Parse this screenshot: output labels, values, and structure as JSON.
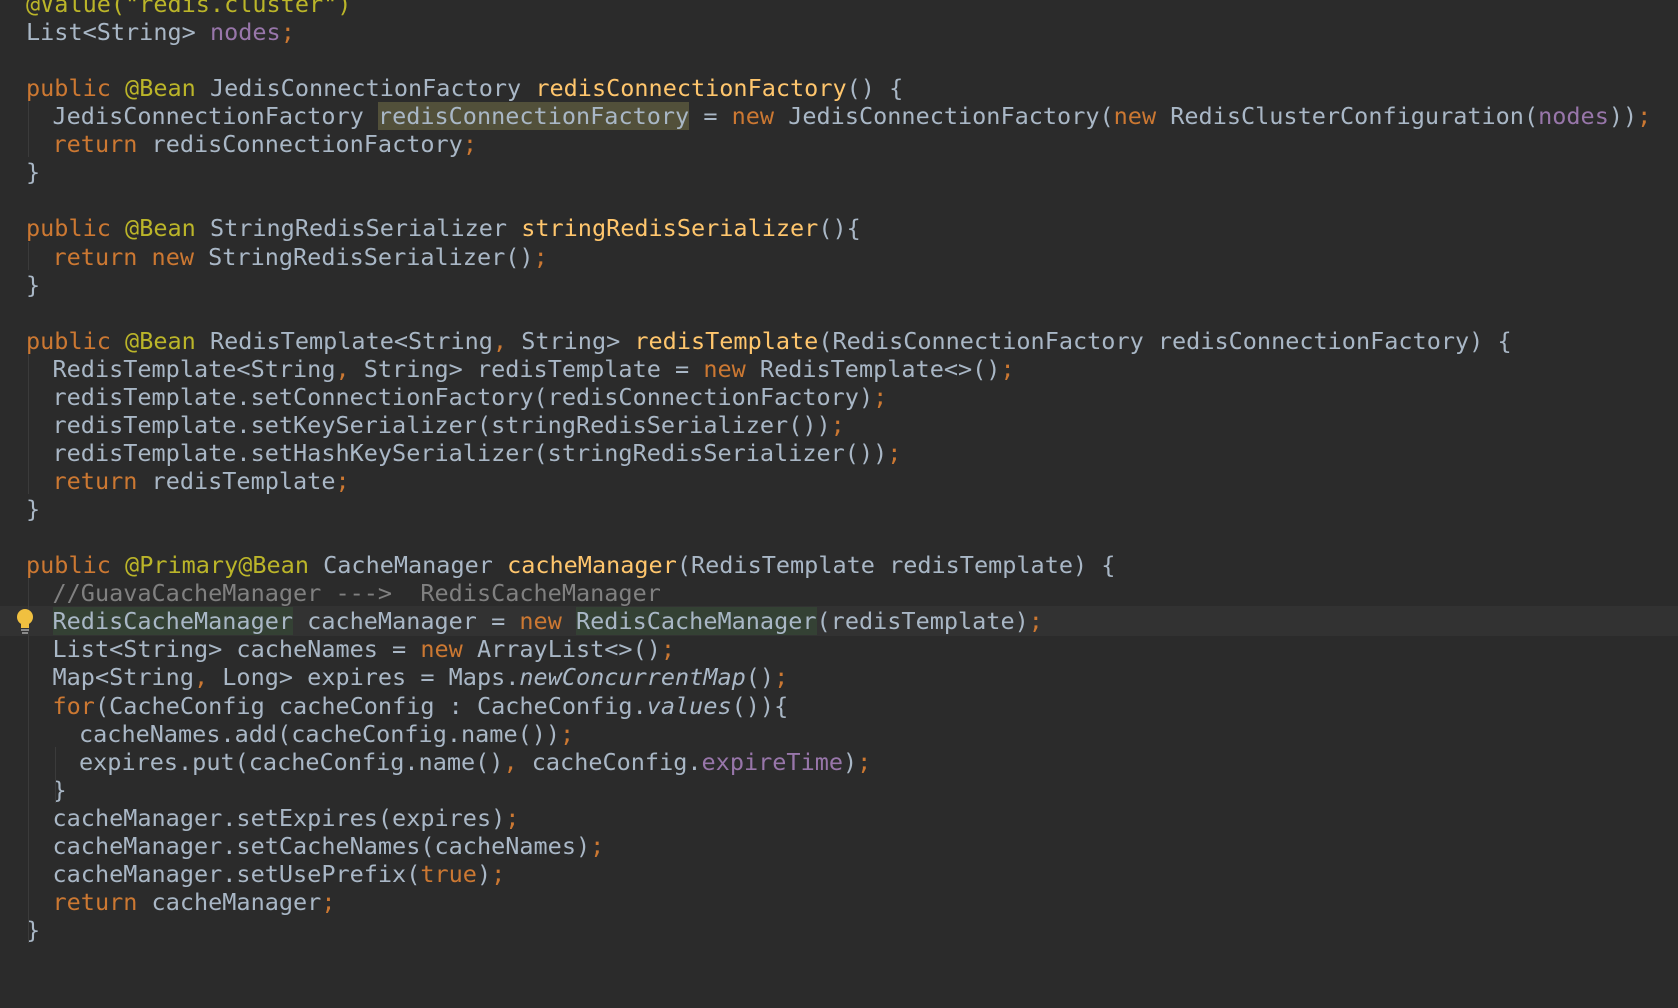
{
  "editor": {
    "language": "java",
    "colors": {
      "background": "#2b2b2b",
      "caret_line": "#323232",
      "keyword": "#cc7832",
      "annotation": "#bbb529",
      "method_declaration": "#ffc66d",
      "field": "#9876aa",
      "plain": "#a9b7c6",
      "comment": "#808080"
    },
    "lightbulb_icon": "intention-bulb-icon",
    "lines": [
      {
        "indent": 0,
        "tokens": [
          {
            "t": "@Value(\"redis.cluster\")",
            "c": "ann"
          }
        ]
      },
      {
        "indent": 0,
        "tokens": [
          {
            "t": "List<String> ",
            "c": "plain"
          },
          {
            "t": "nodes",
            "c": "field"
          },
          {
            "t": ";",
            "c": "punct"
          }
        ]
      },
      {
        "indent": 0,
        "tokens": []
      },
      {
        "indent": 0,
        "tokens": [
          {
            "t": "public ",
            "c": "kw"
          },
          {
            "t": "@Bean ",
            "c": "ann"
          },
          {
            "t": "JedisConnectionFactory ",
            "c": "plain"
          },
          {
            "t": "redisConnectionFactory",
            "c": "fn"
          },
          {
            "t": "() {",
            "c": "plain"
          }
        ]
      },
      {
        "indent": 1,
        "tokens": [
          {
            "t": "JedisConnectionFactory ",
            "c": "plain"
          },
          {
            "t": "redisConnectionFactory",
            "c": "plain",
            "hl": "strong"
          },
          {
            "t": " = ",
            "c": "plain"
          },
          {
            "t": "new ",
            "c": "kw"
          },
          {
            "t": "JedisConnectionFactory(",
            "c": "plain"
          },
          {
            "t": "new ",
            "c": "kw"
          },
          {
            "t": "RedisClusterConfiguration(",
            "c": "plain"
          },
          {
            "t": "nodes",
            "c": "field"
          },
          {
            "t": "))",
            "c": "plain"
          },
          {
            "t": ";",
            "c": "punct"
          }
        ]
      },
      {
        "indent": 1,
        "tokens": [
          {
            "t": "return ",
            "c": "kw"
          },
          {
            "t": "redisConnectionFactory",
            "c": "plain"
          },
          {
            "t": ";",
            "c": "punct"
          }
        ]
      },
      {
        "indent": 0,
        "tokens": [
          {
            "t": "}",
            "c": "plain"
          }
        ]
      },
      {
        "indent": 0,
        "tokens": []
      },
      {
        "indent": 0,
        "tokens": [
          {
            "t": "public ",
            "c": "kw"
          },
          {
            "t": "@Bean ",
            "c": "ann"
          },
          {
            "t": "StringRedisSerializer ",
            "c": "plain"
          },
          {
            "t": "stringRedisSerializer",
            "c": "fn"
          },
          {
            "t": "(){",
            "c": "plain"
          }
        ]
      },
      {
        "indent": 1,
        "tokens": [
          {
            "t": "return ",
            "c": "kw"
          },
          {
            "t": "new ",
            "c": "kw"
          },
          {
            "t": "StringRedisSerializer()",
            "c": "plain"
          },
          {
            "t": ";",
            "c": "punct"
          }
        ]
      },
      {
        "indent": 0,
        "tokens": [
          {
            "t": "}",
            "c": "plain"
          }
        ]
      },
      {
        "indent": 0,
        "tokens": []
      },
      {
        "indent": 0,
        "tokens": [
          {
            "t": "public ",
            "c": "kw"
          },
          {
            "t": "@Bean ",
            "c": "ann"
          },
          {
            "t": "RedisTemplate<String",
            "c": "plain"
          },
          {
            "t": ", ",
            "c": "punct"
          },
          {
            "t": "String> ",
            "c": "plain"
          },
          {
            "t": "redisTemplate",
            "c": "fn"
          },
          {
            "t": "(RedisConnectionFactory redisConnectionFactory) {",
            "c": "plain"
          }
        ]
      },
      {
        "indent": 1,
        "tokens": [
          {
            "t": "RedisTemplate<String",
            "c": "plain"
          },
          {
            "t": ", ",
            "c": "punct"
          },
          {
            "t": "String> redisTemplate = ",
            "c": "plain"
          },
          {
            "t": "new ",
            "c": "kw"
          },
          {
            "t": "RedisTemplate<>()",
            "c": "plain"
          },
          {
            "t": ";",
            "c": "punct"
          }
        ]
      },
      {
        "indent": 1,
        "tokens": [
          {
            "t": "redisTemplate.setConnectionFactory(redisConnectionFactory)",
            "c": "plain"
          },
          {
            "t": ";",
            "c": "punct"
          }
        ]
      },
      {
        "indent": 1,
        "tokens": [
          {
            "t": "redisTemplate.setKeySerializer(stringRedisSerializer())",
            "c": "plain"
          },
          {
            "t": ";",
            "c": "punct"
          }
        ]
      },
      {
        "indent": 1,
        "tokens": [
          {
            "t": "redisTemplate.setHashKeySerializer(stringRedisSerializer())",
            "c": "plain"
          },
          {
            "t": ";",
            "c": "punct"
          }
        ]
      },
      {
        "indent": 1,
        "tokens": [
          {
            "t": "return ",
            "c": "kw"
          },
          {
            "t": "redisTemplate",
            "c": "plain"
          },
          {
            "t": ";",
            "c": "punct"
          }
        ]
      },
      {
        "indent": 0,
        "tokens": [
          {
            "t": "}",
            "c": "plain"
          }
        ]
      },
      {
        "indent": 0,
        "tokens": []
      },
      {
        "indent": 0,
        "tokens": [
          {
            "t": "public ",
            "c": "kw"
          },
          {
            "t": "@Primary@Bean ",
            "c": "ann"
          },
          {
            "t": "CacheManager ",
            "c": "plain"
          },
          {
            "t": "cacheManager",
            "c": "fn"
          },
          {
            "t": "(RedisTemplate redisTemplate) {",
            "c": "plain"
          }
        ]
      },
      {
        "indent": 1,
        "tokens": [
          {
            "t": "//GuavaCacheManager --->  RedisCacheManager",
            "c": "comment"
          }
        ]
      },
      {
        "indent": 1,
        "caret": true,
        "tokens": [
          {
            "t": "RedisCacheManager",
            "c": "plain",
            "hl": "usage"
          },
          {
            "t": " cacheManager = ",
            "c": "plain"
          },
          {
            "t": "new ",
            "c": "kw"
          },
          {
            "t": "RedisCacheManager",
            "c": "plain",
            "hl": "usage"
          },
          {
            "t": "(redisTemplate)",
            "c": "plain"
          },
          {
            "t": ";",
            "c": "punct"
          }
        ]
      },
      {
        "indent": 1,
        "tokens": [
          {
            "t": "List<String> cacheNames = ",
            "c": "plain"
          },
          {
            "t": "new ",
            "c": "kw"
          },
          {
            "t": "ArrayList<>()",
            "c": "plain"
          },
          {
            "t": ";",
            "c": "punct"
          }
        ]
      },
      {
        "indent": 1,
        "tokens": [
          {
            "t": "Map<String",
            "c": "plain"
          },
          {
            "t": ", ",
            "c": "punct"
          },
          {
            "t": "Long> expires = Maps.",
            "c": "plain"
          },
          {
            "t": "newConcurrentMap",
            "c": "italic"
          },
          {
            "t": "()",
            "c": "plain"
          },
          {
            "t": ";",
            "c": "punct"
          }
        ]
      },
      {
        "indent": 1,
        "tokens": [
          {
            "t": "for",
            "c": "kw"
          },
          {
            "t": "(CacheConfig cacheConfig : CacheConfig.",
            "c": "plain"
          },
          {
            "t": "values",
            "c": "italic"
          },
          {
            "t": "()){",
            "c": "plain"
          }
        ]
      },
      {
        "indent": 2,
        "tokens": [
          {
            "t": "cacheNames.add(cacheConfig.name())",
            "c": "plain"
          },
          {
            "t": ";",
            "c": "punct"
          }
        ]
      },
      {
        "indent": 2,
        "tokens": [
          {
            "t": "expires.put(cacheConfig.name()",
            "c": "plain"
          },
          {
            "t": ", ",
            "c": "punct"
          },
          {
            "t": "cacheConfig.",
            "c": "plain"
          },
          {
            "t": "expireTime",
            "c": "field"
          },
          {
            "t": ")",
            "c": "plain"
          },
          {
            "t": ";",
            "c": "punct"
          }
        ]
      },
      {
        "indent": 1,
        "tokens": [
          {
            "t": "}",
            "c": "plain"
          }
        ]
      },
      {
        "indent": 1,
        "tokens": [
          {
            "t": "cacheManager.setExpires(expires)",
            "c": "plain"
          },
          {
            "t": ";",
            "c": "punct"
          }
        ]
      },
      {
        "indent": 1,
        "tokens": [
          {
            "t": "cacheManager.setCacheNames(cacheNames)",
            "c": "plain"
          },
          {
            "t": ";",
            "c": "punct"
          }
        ]
      },
      {
        "indent": 1,
        "tokens": [
          {
            "t": "cacheManager.setUsePrefix(",
            "c": "plain"
          },
          {
            "t": "true",
            "c": "kw"
          },
          {
            "t": ")",
            "c": "plain"
          },
          {
            "t": ";",
            "c": "punct"
          }
        ]
      },
      {
        "indent": 1,
        "tokens": [
          {
            "t": "return ",
            "c": "kw"
          },
          {
            "t": "cacheManager",
            "c": "plain"
          },
          {
            "t": ";",
            "c": "punct"
          }
        ]
      },
      {
        "indent": 0,
        "tokens": [
          {
            "t": "}",
            "c": "plain"
          }
        ]
      }
    ]
  }
}
